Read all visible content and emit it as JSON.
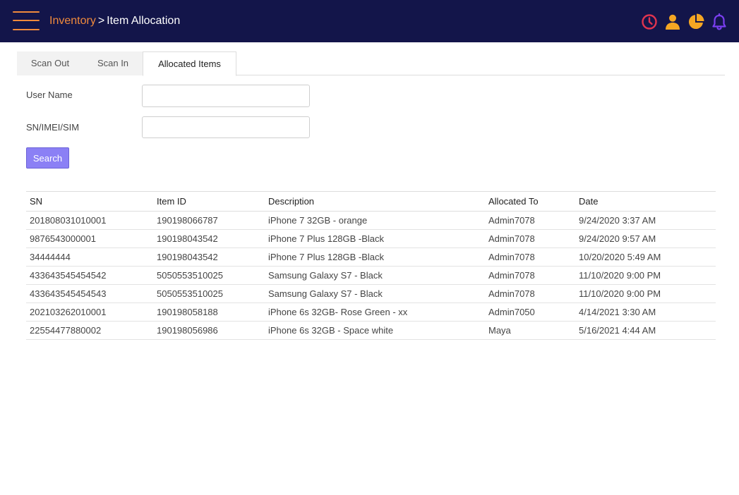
{
  "header": {
    "breadcrumb_parent": "Inventory",
    "breadcrumb_separator": ">",
    "breadcrumb_current": "Item Allocation",
    "icons": [
      "clock-icon",
      "user-icon",
      "pie-chart-icon",
      "bell-icon"
    ],
    "colors": {
      "background": "#13154a",
      "accent": "#f08a3c",
      "clock": "#e0344f",
      "user": "#f5a623",
      "chart": "#f5a623",
      "bell": "#7b3ff2"
    }
  },
  "tabs": [
    {
      "label": "Scan Out",
      "active": false
    },
    {
      "label": "Scan In",
      "active": false
    },
    {
      "label": "Allocated Items",
      "active": true
    }
  ],
  "form": {
    "user_name_label": "User Name",
    "user_name_value": "",
    "sn_label": "SN/IMEI/SIM",
    "sn_value": "",
    "search_label": "Search"
  },
  "table": {
    "columns": [
      "SN",
      "Item ID",
      "Description",
      "Allocated To",
      "Date"
    ],
    "rows": [
      [
        "201808031010001",
        "190198066787",
        "iPhone 7 32GB - orange",
        "Admin7078",
        "9/24/2020 3:37 AM"
      ],
      [
        "9876543000001",
        "190198043542",
        "iPhone 7 Plus 128GB -Black",
        "Admin7078",
        "9/24/2020 9:57 AM"
      ],
      [
        "34444444",
        "190198043542",
        "iPhone 7 Plus 128GB -Black",
        "Admin7078",
        "10/20/2020 5:49 AM"
      ],
      [
        "433643545454542",
        "5050553510025",
        "Samsung Galaxy S7 - Black",
        "Admin7078",
        "11/10/2020 9:00 PM"
      ],
      [
        "433643545454543",
        "5050553510025",
        "Samsung Galaxy S7 - Black",
        "Admin7078",
        "11/10/2020 9:00 PM"
      ],
      [
        "202103262010001",
        "190198058188",
        "iPhone 6s 32GB- Rose Green - xx",
        "Admin7050",
        "4/14/2021 3:30 AM"
      ],
      [
        "22554477880002",
        "190198056986",
        "iPhone 6s 32GB - Space white",
        "Maya",
        "5/16/2021 4:44 AM"
      ]
    ]
  }
}
